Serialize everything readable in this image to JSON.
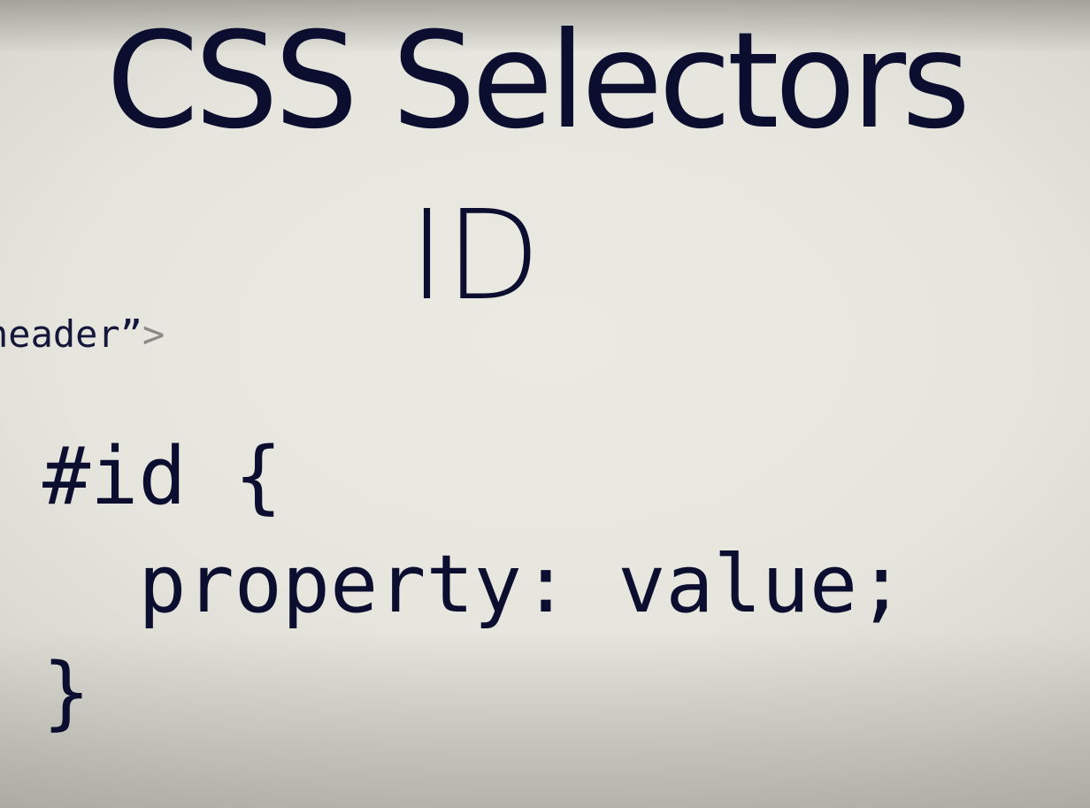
{
  "slide": {
    "title": "CSS Selectors",
    "subtitle": "ID",
    "fragment_text": "header”",
    "fragment_angle": ">",
    "code": {
      "line1": "#id {",
      "line2": "  property: value;",
      "line3": "}"
    }
  },
  "colors": {
    "text": "#0c0e30",
    "background": "#e6e6de",
    "angle_bracket": "#8a8a86"
  }
}
